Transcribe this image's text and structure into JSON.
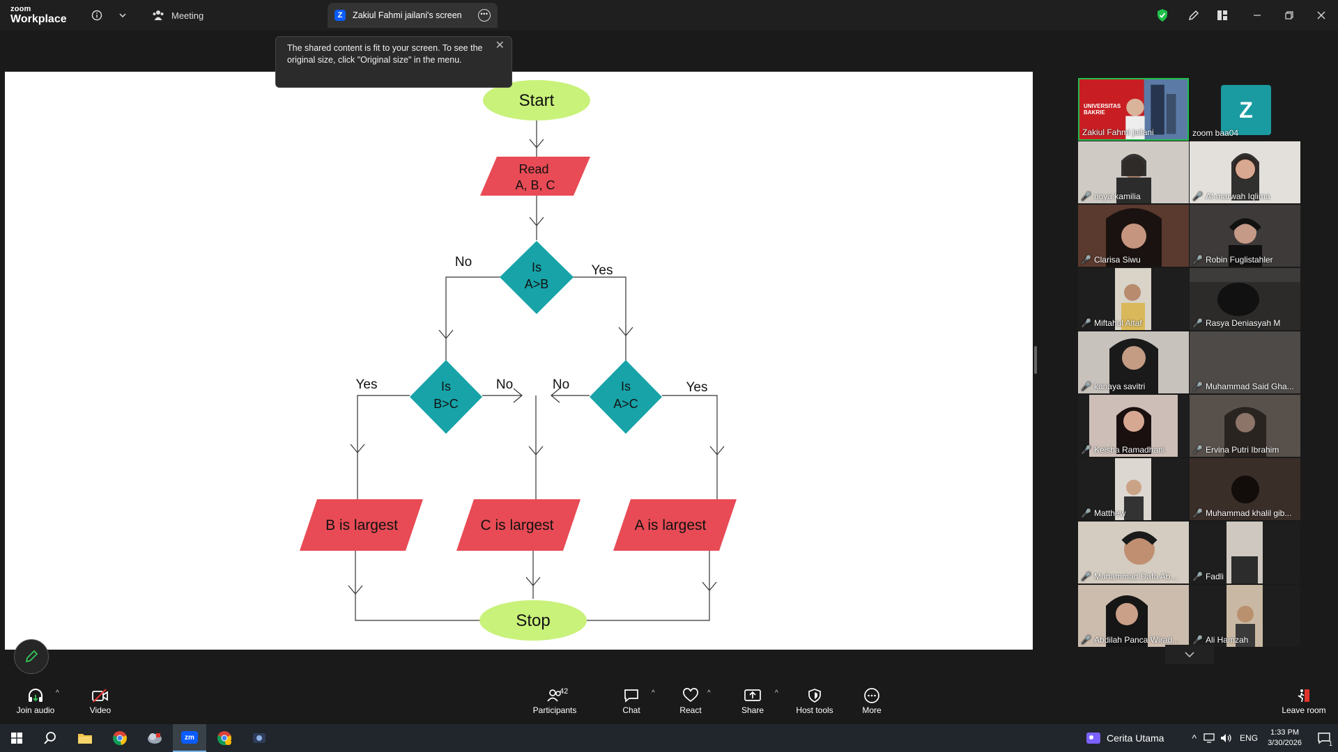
{
  "app": {
    "brand_small": "zoom",
    "brand_big": "Workplace"
  },
  "titlebar": {
    "meeting_label": "Meeting",
    "screen_tab_label": "Zakiul Fahmi jailani's screen",
    "screen_tab_badge": "Z"
  },
  "toast": {
    "message": "The shared content is fit to your screen. To see the original size, click \"Original size\" in the menu."
  },
  "flowchart": {
    "start": "Start",
    "read_line1": "Read",
    "read_line2": "A, B, C",
    "d1_line1": "Is",
    "d1_line2": "A>B",
    "d2_line1": "Is",
    "d2_line2": "B>C",
    "d3_line1": "Is",
    "d3_line2": "A>C",
    "no1": "No",
    "yes1": "Yes",
    "yes2": "Yes",
    "no2": "No",
    "no3": "No",
    "yes3": "Yes",
    "out_b": "B is largest",
    "out_c": "C is largest",
    "out_a": "A is largest",
    "stop": "Stop"
  },
  "gallery": {
    "participants": [
      {
        "name": "Zakiul Fahmi jailani",
        "muted": false,
        "active": true
      },
      {
        "name": "zoom baa04",
        "muted": false,
        "initial": "Z"
      },
      {
        "name": "noya kamilia",
        "muted": true
      },
      {
        "name": "Al-marwah Iqlima",
        "muted": true
      },
      {
        "name": "Clarisa Siwu",
        "muted": true
      },
      {
        "name": "Robin Fuglistahler",
        "muted": true
      },
      {
        "name": "Miftahul Altaf",
        "muted": true
      },
      {
        "name": "Rasya Deniasyah M",
        "muted": true
      },
      {
        "name": "kanaya savitri",
        "muted": true
      },
      {
        "name": "Muhammad Said Gha...",
        "muted": true
      },
      {
        "name": "Keisha Ramadhani",
        "muted": true
      },
      {
        "name": "Ervina Putri Ibrahim",
        "muted": true
      },
      {
        "name": "Matthew",
        "muted": true
      },
      {
        "name": "Muhammad khalil gib...",
        "muted": true
      },
      {
        "name": "Muhammad Dafa Ab...",
        "muted": true
      },
      {
        "name": "Fadli",
        "muted": true
      },
      {
        "name": "Abdilah Panca Wirad...",
        "muted": true
      },
      {
        "name": "Ali Hamzah",
        "muted": true
      }
    ],
    "banner_text": "UNIVERSITAS BAKRIE"
  },
  "toolbar": {
    "join_audio": "Join audio",
    "video": "Video",
    "participants": "Participants",
    "participants_count": "42",
    "chat": "Chat",
    "react": "React",
    "share": "Share",
    "host_tools": "Host tools",
    "more": "More",
    "leave": "Leave room"
  },
  "taskbar": {
    "weather": "Cerita Utama",
    "lang": "ENG",
    "time": "1:33 PM",
    "date": "3/30/2026",
    "notif_count": "1"
  },
  "colors": {
    "terminal": "#c9f27a",
    "process": "#e84b55",
    "decision": "#17a3a8",
    "toolbar_bg": "#1a1a1a",
    "active_border": "#1fbf4a"
  }
}
